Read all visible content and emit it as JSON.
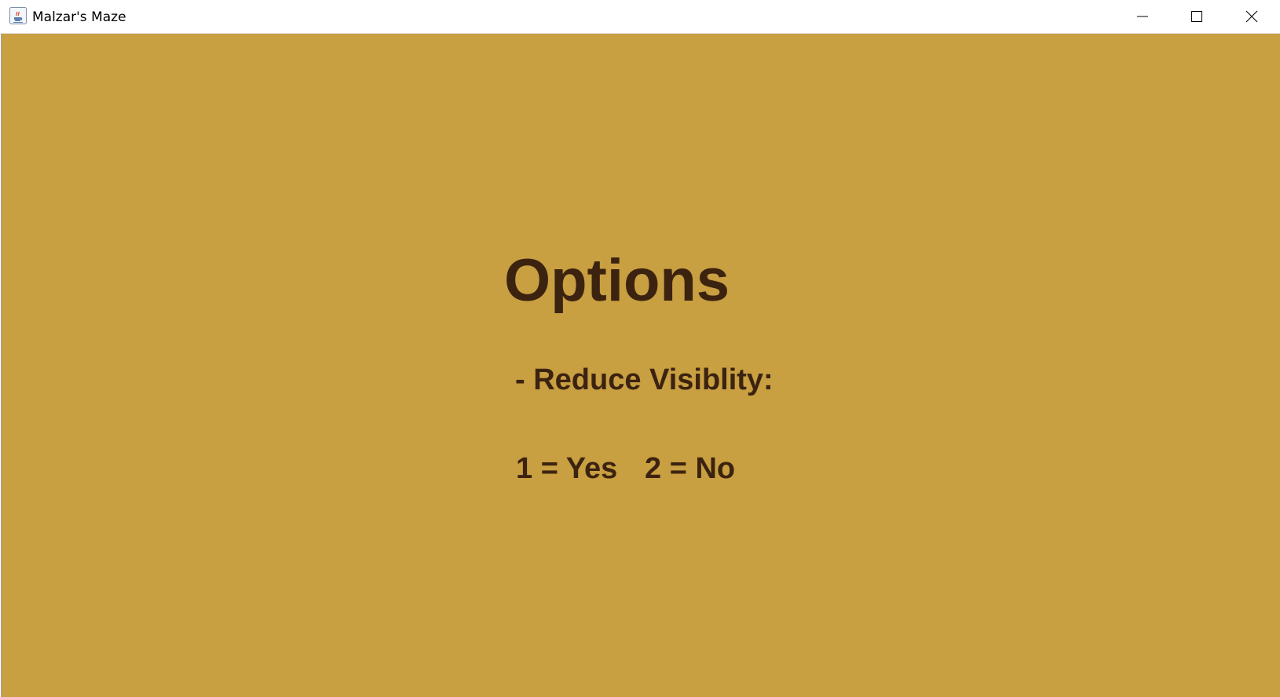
{
  "window": {
    "title": "Malzar's Maze",
    "app_icon": "java-cup-icon",
    "controls": {
      "minimize": "minimize-icon",
      "maximize": "maximize-icon",
      "close": "close-icon"
    }
  },
  "screen": {
    "heading": "Options",
    "option_label": "- Reduce Visiblity:",
    "choices": [
      {
        "key": "1",
        "text": "1 = Yes"
      },
      {
        "key": "2",
        "text": "2 = No"
      }
    ]
  },
  "colors": {
    "background": "#c89f41",
    "text": "#3c2310",
    "titlebar": "#ffffff"
  }
}
